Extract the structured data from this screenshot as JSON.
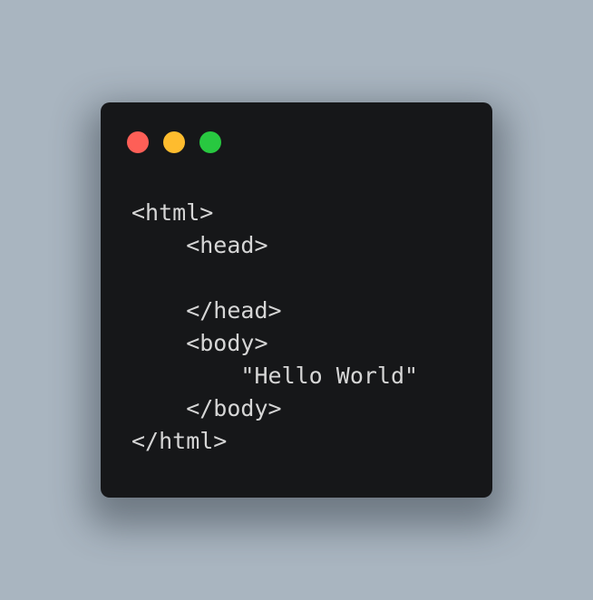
{
  "window": {
    "controls": {
      "close": {
        "icon": "close-dot-icon",
        "color": "#fe5f57"
      },
      "minimize": {
        "icon": "minimize-dot-icon",
        "color": "#febc2e"
      },
      "zoom": {
        "icon": "zoom-dot-icon",
        "color": "#28c840"
      }
    },
    "background_color": "#161719",
    "text_color": "#d6d6d6"
  },
  "page": {
    "background_color": "#a9b5c0"
  },
  "code": {
    "lines": [
      "<html>",
      "    <head>",
      "",
      "    </head>",
      "    <body>",
      "        \"Hello World\"",
      "    </body>",
      "</html>"
    ]
  }
}
